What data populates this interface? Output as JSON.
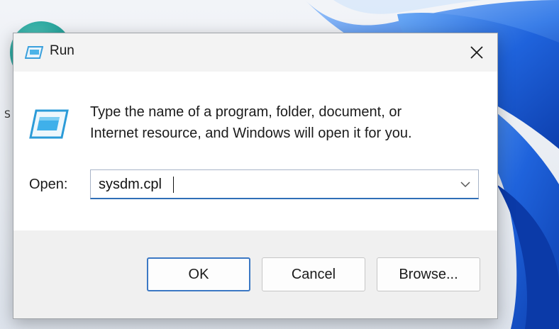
{
  "window": {
    "title": "Run",
    "close_icon": "close-icon"
  },
  "content": {
    "icon": "run-icon",
    "description_line1": "Type the name of a program, folder, document, or",
    "description_line2": "Internet resource, and Windows will open it for you."
  },
  "open_field": {
    "label": "Open:",
    "value": "sysdm.cpl",
    "dropdown_icon": "chevron-down-icon"
  },
  "buttons": {
    "ok": "OK",
    "cancel": "Cancel",
    "browse": "Browse..."
  },
  "colors": {
    "accent": "#2f6fb7",
    "dialog_background": "#f0f0f0",
    "content_background": "#ffffff",
    "wallpaper_blue": "#1a5fd6"
  }
}
